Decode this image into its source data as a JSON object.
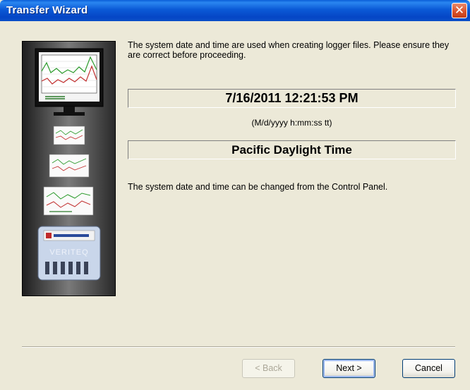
{
  "window": {
    "title": "Transfer Wizard"
  },
  "content": {
    "intro": "The system date and time are used when creating logger files. Please ensure they are correct before proceeding.",
    "datetime": "7/16/2011 12:21:53 PM",
    "format_hint": "(M/d/yyyy h:mm:ss tt)",
    "timezone": "Pacific Daylight Time",
    "footnote": "The system date and time can be changed from the Control Panel."
  },
  "side_image": {
    "logo_text": "VERITEQ"
  },
  "buttons": {
    "back": "< Back",
    "next": "Next >",
    "cancel": "Cancel"
  },
  "icons": {
    "close": "close-icon"
  },
  "colors": {
    "titlebar": "#0b5ad6",
    "close": "#d8502a",
    "background": "#ece9d8"
  }
}
